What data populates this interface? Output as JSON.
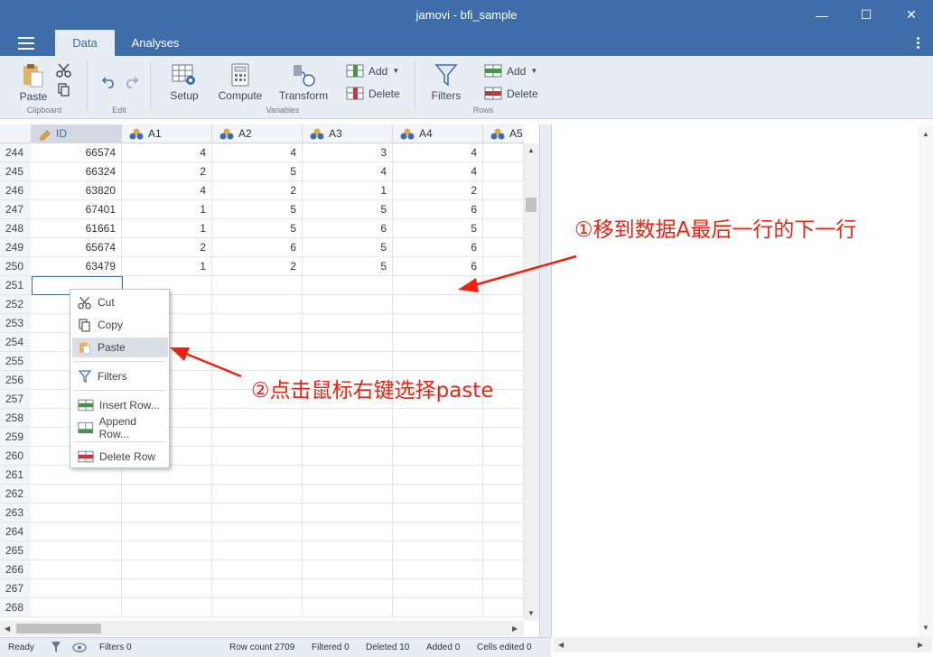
{
  "window": {
    "title": "jamovi - bfi_sample",
    "minimize": "—",
    "maximize": "☐",
    "close": "✕"
  },
  "tabs": [
    {
      "label": "Data",
      "active": true
    },
    {
      "label": "Analyses",
      "active": false
    }
  ],
  "ribbon": {
    "paste_label": "Paste",
    "clipboard_group": "Clipboard",
    "edit_group": "Edit",
    "setup_label": "Setup",
    "compute_label": "Compute",
    "transform_label": "Transform",
    "variables_group": "Variables",
    "var_add_label": "Add",
    "var_delete_label": "Delete",
    "filters_label": "Filters",
    "row_add_label": "Add",
    "row_delete_label": "Delete",
    "rows_group": "Rows"
  },
  "columns": [
    "ID",
    "A1",
    "A2",
    "A3",
    "A4",
    "A5"
  ],
  "rows": [
    {
      "n": "244",
      "cells": [
        "66574",
        "4",
        "4",
        "3",
        "4"
      ]
    },
    {
      "n": "245",
      "cells": [
        "66324",
        "2",
        "5",
        "4",
        "4"
      ]
    },
    {
      "n": "246",
      "cells": [
        "63820",
        "4",
        "2",
        "1",
        "2"
      ]
    },
    {
      "n": "247",
      "cells": [
        "67401",
        "1",
        "5",
        "5",
        "6"
      ]
    },
    {
      "n": "248",
      "cells": [
        "61661",
        "1",
        "5",
        "6",
        "5"
      ]
    },
    {
      "n": "249",
      "cells": [
        "65674",
        "2",
        "6",
        "5",
        "6"
      ]
    },
    {
      "n": "250",
      "cells": [
        "63479",
        "1",
        "2",
        "5",
        "6"
      ]
    },
    {
      "n": "251",
      "cells": [
        "",
        "",
        "",
        "",
        ""
      ]
    },
    {
      "n": "252",
      "cells": [
        "",
        "",
        "",
        "",
        ""
      ]
    },
    {
      "n": "253",
      "cells": [
        "",
        "",
        "",
        "",
        ""
      ]
    },
    {
      "n": "254",
      "cells": [
        "",
        "",
        "",
        "",
        ""
      ]
    },
    {
      "n": "255",
      "cells": [
        "",
        "",
        "",
        "",
        ""
      ]
    },
    {
      "n": "256",
      "cells": [
        "",
        "",
        "",
        "",
        ""
      ]
    },
    {
      "n": "257",
      "cells": [
        "",
        "",
        "",
        "",
        ""
      ]
    },
    {
      "n": "258",
      "cells": [
        "",
        "",
        "",
        "",
        ""
      ]
    },
    {
      "n": "259",
      "cells": [
        "",
        "",
        "",
        "",
        ""
      ]
    },
    {
      "n": "260",
      "cells": [
        "",
        "",
        "",
        "",
        ""
      ]
    },
    {
      "n": "261",
      "cells": [
        "",
        "",
        "",
        "",
        ""
      ]
    },
    {
      "n": "262",
      "cells": [
        "",
        "",
        "",
        "",
        ""
      ]
    },
    {
      "n": "263",
      "cells": [
        "",
        "",
        "",
        "",
        ""
      ]
    },
    {
      "n": "264",
      "cells": [
        "",
        "",
        "",
        "",
        ""
      ]
    },
    {
      "n": "265",
      "cells": [
        "",
        "",
        "",
        "",
        ""
      ]
    },
    {
      "n": "266",
      "cells": [
        "",
        "",
        "",
        "",
        ""
      ]
    },
    {
      "n": "267",
      "cells": [
        "",
        "",
        "",
        "",
        ""
      ]
    },
    {
      "n": "268",
      "cells": [
        "",
        "",
        "",
        "",
        ""
      ]
    }
  ],
  "context_menu": {
    "cut": "Cut",
    "copy": "Copy",
    "paste": "Paste",
    "filters": "Filters",
    "insert_row": "Insert Row...",
    "append_row": "Append Row...",
    "delete_row": "Delete Row"
  },
  "status": {
    "ready": "Ready",
    "filters": "Filters 0",
    "row_count": "Row count 2709",
    "filtered": "Filtered 0",
    "deleted": "Deleted 10",
    "added": "Added 0",
    "cells_edited": "Cells edited 0"
  },
  "annotations": {
    "step1": "①移到数据A最后一行的下一行",
    "step2": "②点击鼠标右键选择paste"
  },
  "colors": {
    "brand": "#3e6da9",
    "ribbon": "#e8edf3",
    "annotation": "#ee2211"
  }
}
